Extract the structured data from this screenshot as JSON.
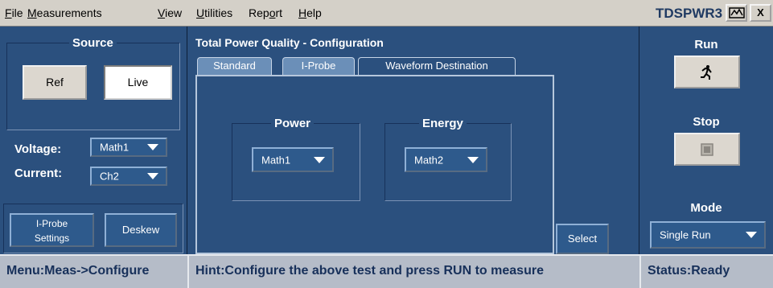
{
  "menubar": {
    "items": [
      {
        "pre": "",
        "u": "F",
        "post": "ile"
      },
      {
        "pre": "",
        "u": "M",
        "post": "easurements"
      },
      {
        "pre": "",
        "u": "V",
        "post": "iew"
      },
      {
        "pre": "",
        "u": "U",
        "post": "tilities"
      },
      {
        "pre": "Rep",
        "u": "o",
        "post": "rt"
      },
      {
        "pre": "",
        "u": "H",
        "post": "elp"
      }
    ],
    "brand": "TDSPWR3",
    "close_label": "X"
  },
  "source": {
    "title": "Source",
    "ref_label": "Ref",
    "live_label": "Live"
  },
  "voltage": {
    "label": "Voltage:",
    "value": "Math1"
  },
  "current": {
    "label": "Current:",
    "value": "Ch2"
  },
  "iprobe_settings": {
    "line1": "I-Probe",
    "line2": "Settings"
  },
  "deskew_label": "Deskew",
  "config": {
    "title": "Total Power Quality - Configuration",
    "tabs": [
      "Standard",
      "I-Probe",
      "Waveform Destination"
    ],
    "power": {
      "title": "Power",
      "value": "Math1"
    },
    "energy": {
      "title": "Energy",
      "value": "Math2"
    },
    "select_label": "Select"
  },
  "controls": {
    "run_label": "Run",
    "stop_label": "Stop",
    "mode_label": "Mode",
    "mode_value": "Single Run"
  },
  "statusbar": {
    "menu": "Menu:Meas->Configure",
    "hint": "Hint:Configure the above test and press RUN to measure",
    "status": "Status:Ready"
  }
}
